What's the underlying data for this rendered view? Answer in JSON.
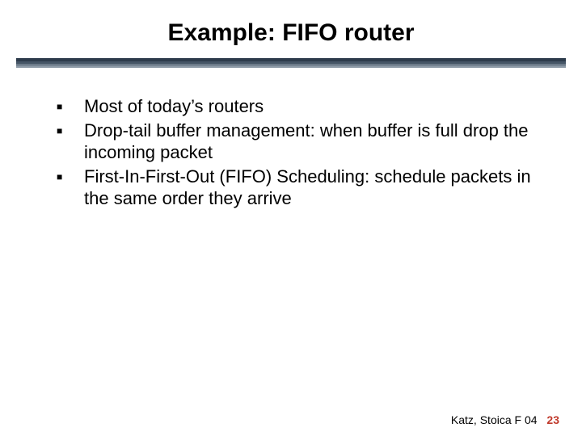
{
  "title": "Example: FIFO router",
  "bullets": [
    "Most of today’s routers",
    "Drop-tail buffer management: when buffer is full drop the incoming packet",
    "First-In-First-Out (FIFO) Scheduling: schedule packets in the same order they arrive"
  ],
  "footer": {
    "text": "Katz, Stoica F 04",
    "page": "23"
  }
}
